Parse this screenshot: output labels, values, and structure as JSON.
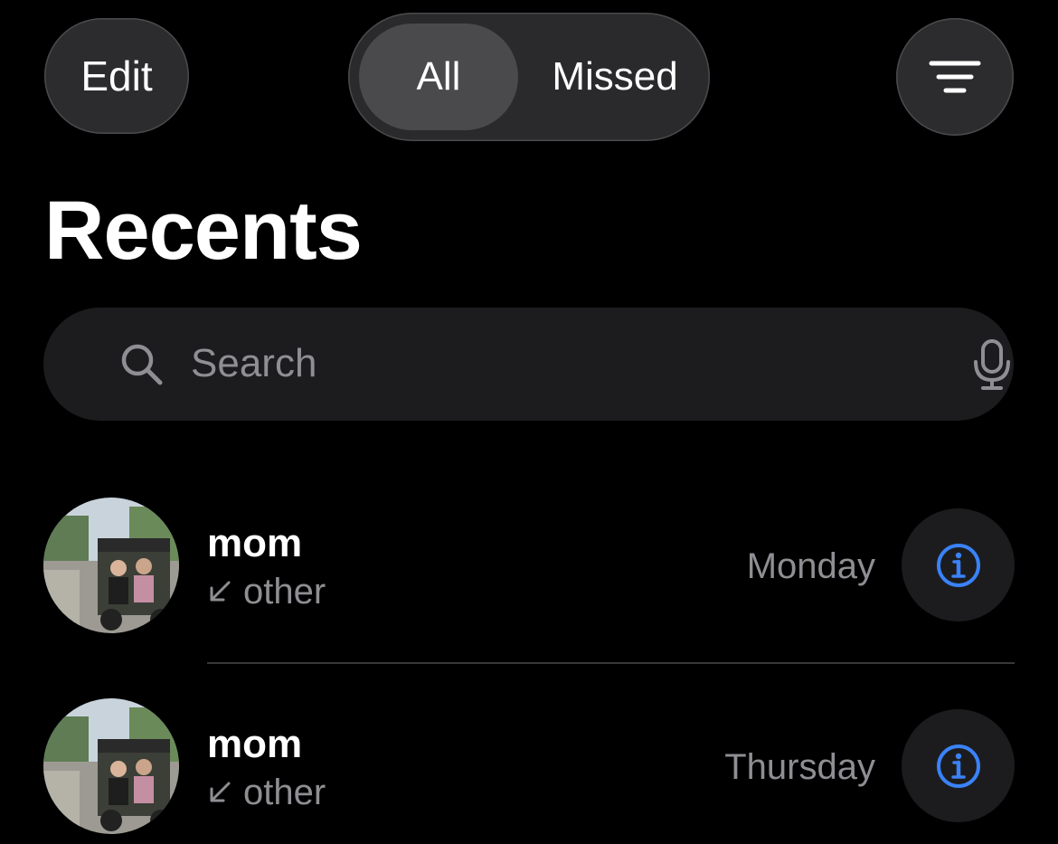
{
  "toolbar": {
    "edit_label": "Edit",
    "filter_icon": "filter-lines-icon"
  },
  "segmented": {
    "items": [
      {
        "label": "All",
        "selected": true
      },
      {
        "label": "Missed",
        "selected": false
      }
    ]
  },
  "page_title": "Recents",
  "search": {
    "placeholder": "Search",
    "value": "",
    "icon": "magnifying-glass-icon",
    "mic_icon": "microphone-icon"
  },
  "calls": [
    {
      "name": "mom",
      "type_label": "other",
      "direction_icon": "incoming-arrow-icon",
      "date": "Monday",
      "info_icon": "info-circle-icon"
    },
    {
      "name": "mom",
      "type_label": "other",
      "direction_icon": "incoming-arrow-icon",
      "date": "Thursday",
      "info_icon": "info-circle-icon"
    }
  ],
  "colors": {
    "background": "#000000",
    "button_bg": "#2c2c2e",
    "accent_blue": "#3a82f7",
    "secondary_text": "#8e8e93"
  }
}
